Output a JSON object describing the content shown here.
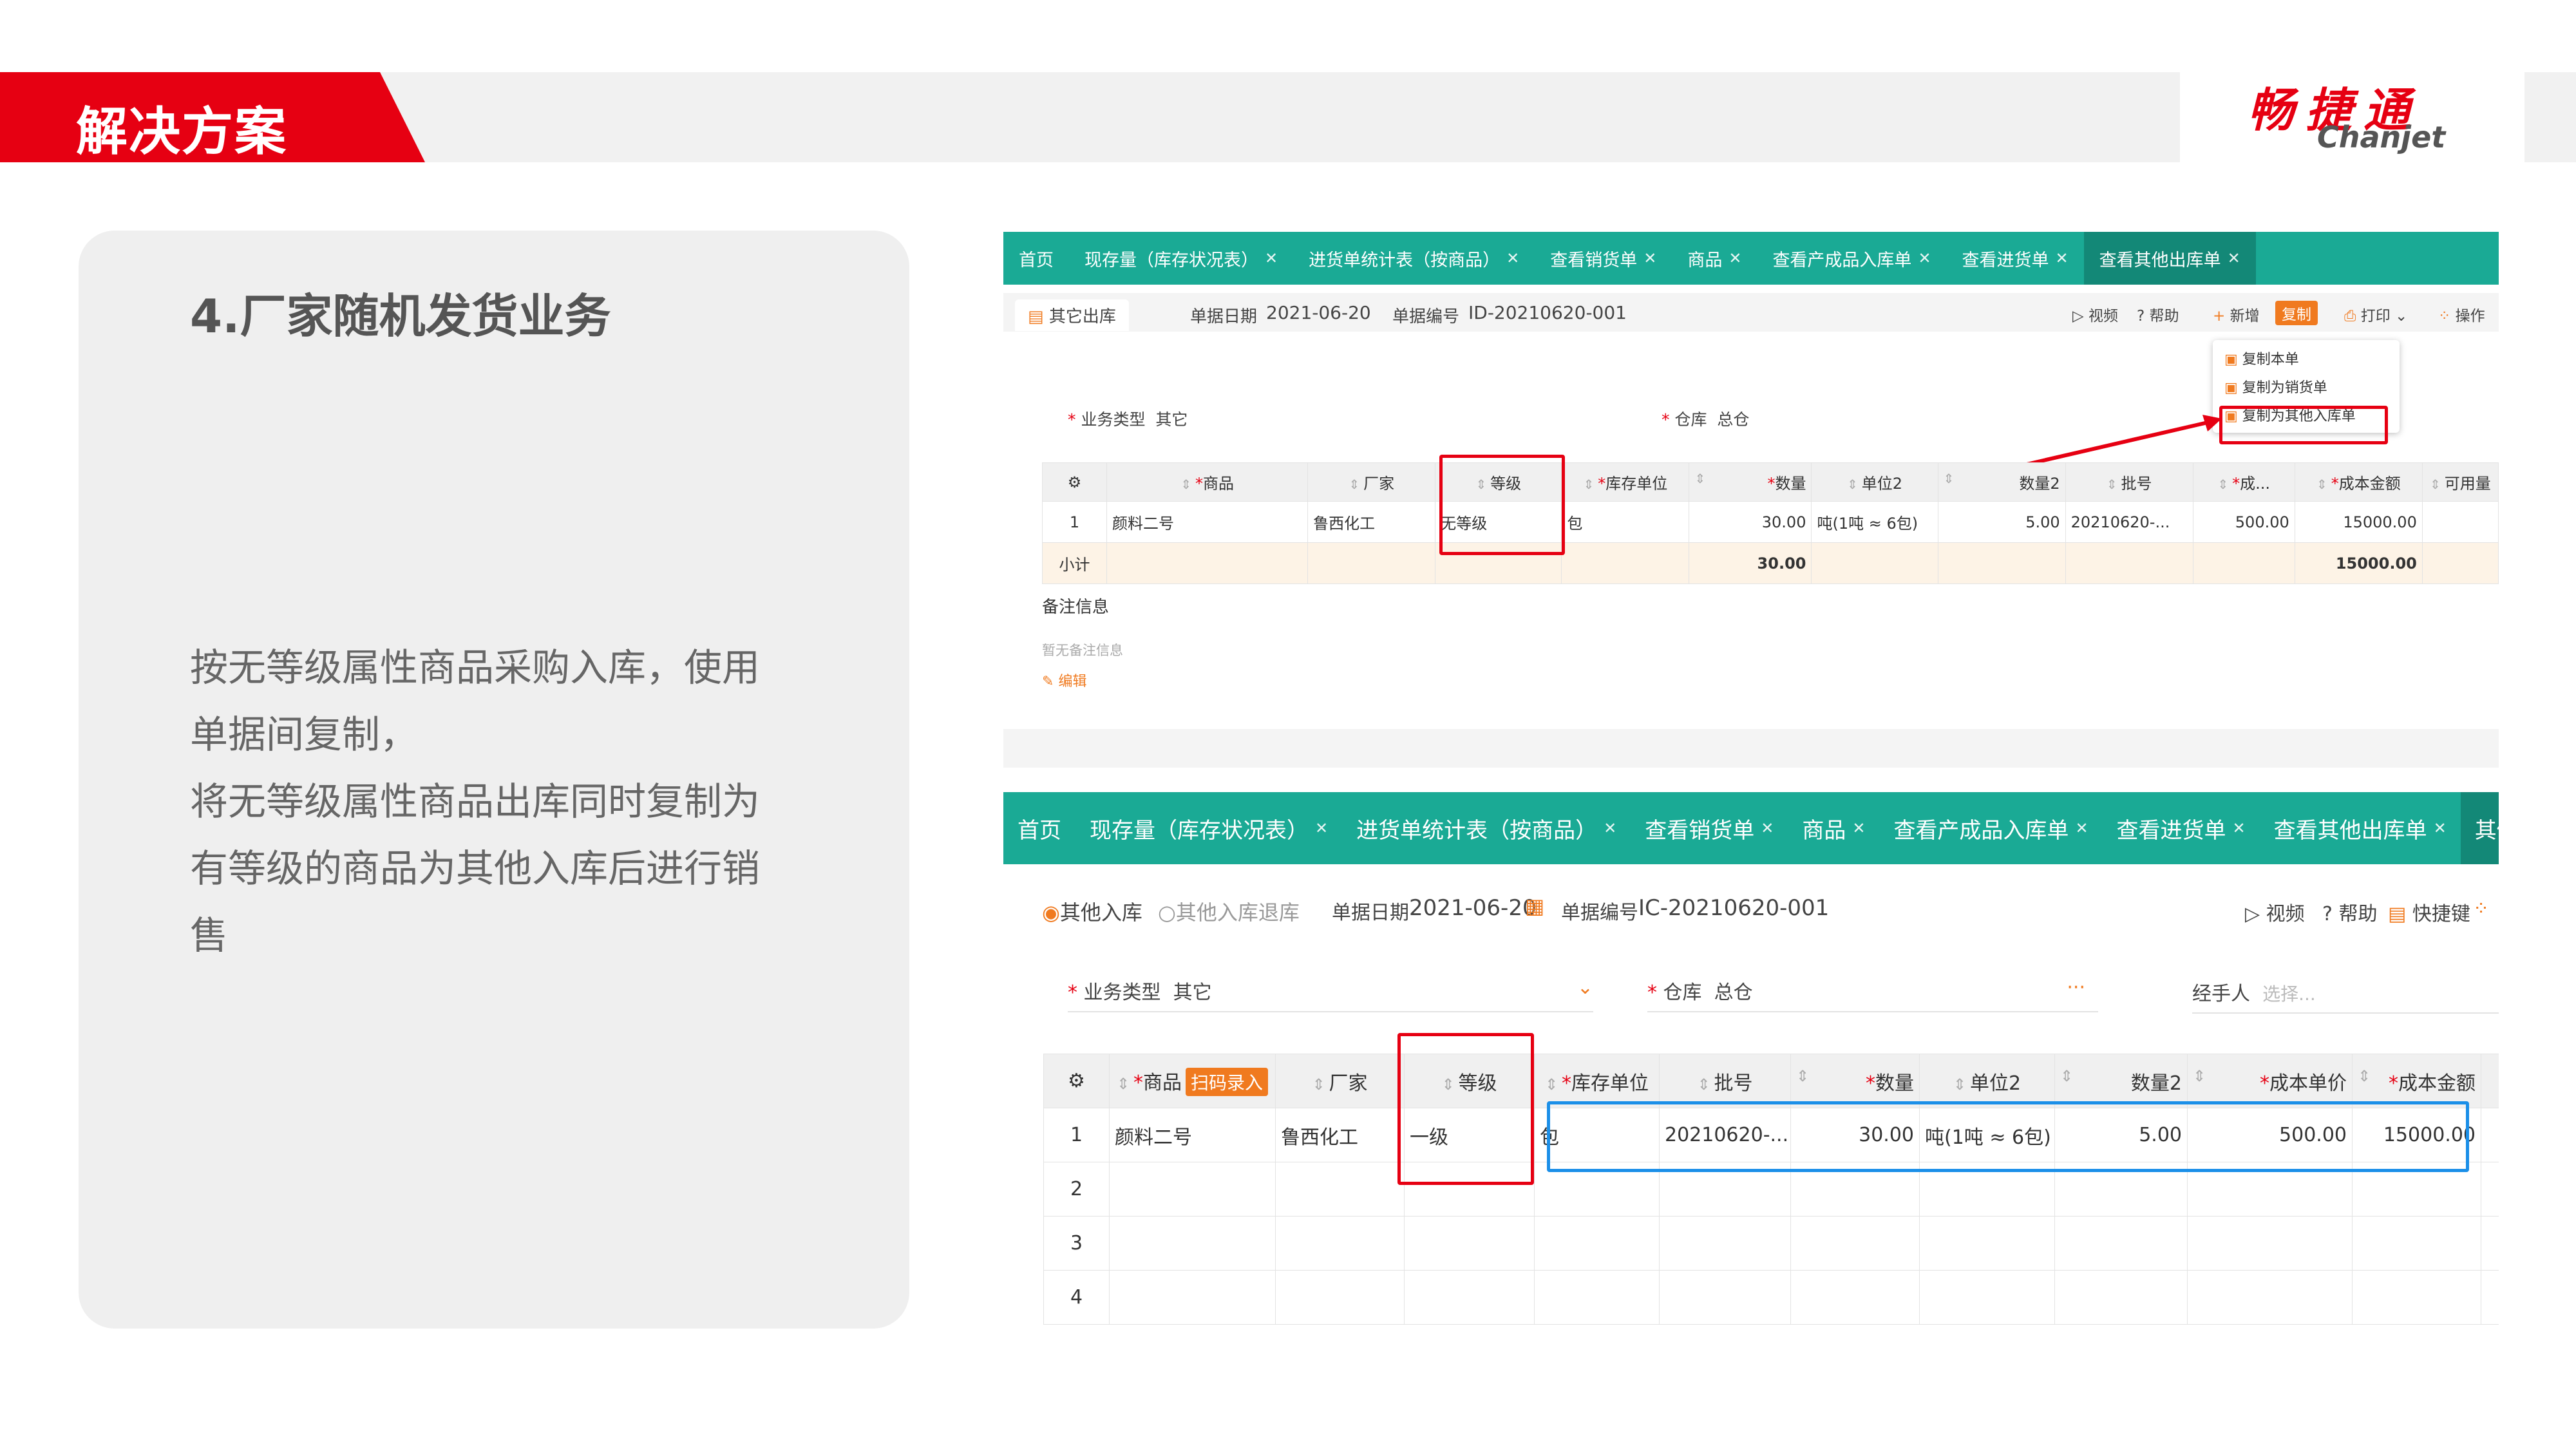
{
  "slide": {
    "section_tab": "解决方案",
    "logo_cn": "畅捷通",
    "logo_en": "Chanjet",
    "title": "4.厂家随机发货业务",
    "body_lines": [
      "按无等级属性商品采购入库，使用",
      "单据间复制，",
      "将无等级属性商品出库同时复制为",
      "有等级的商品为其他入库后进行销",
      "售"
    ],
    "colors": {
      "brand_red": "#e60012",
      "tab_teal": "#1aaa95",
      "highlight_blue": "#1b8fe8"
    }
  },
  "screen1": {
    "tabs": [
      {
        "label": "首页",
        "closable": false
      },
      {
        "label": "现存量（库存状况表）",
        "closable": true
      },
      {
        "label": "进货单统计表（按商品）",
        "closable": true
      },
      {
        "label": "查看销货单",
        "closable": true
      },
      {
        "label": "商品",
        "closable": true
      },
      {
        "label": "查看产成品入库单",
        "closable": true
      },
      {
        "label": "查看进货单",
        "closable": true
      },
      {
        "label": "查看其他出库单",
        "closable": true,
        "active": true
      }
    ],
    "doc_type": "其它出库",
    "date_label": "单据日期",
    "date_value": "2021-06-20",
    "code_label": "单据编号",
    "code_value": "ID-20210620-001",
    "toolbar": {
      "video": "视频",
      "help": "帮助",
      "add": "新增",
      "copy": "复制",
      "print": "打印",
      "ops": "操作"
    },
    "dropdown": [
      "复制本单",
      "复制为销货单",
      "复制为其他入库单"
    ],
    "biz_type_label": "业务类型",
    "biz_type_value": "其它",
    "warehouse_label": "仓库",
    "warehouse_value": "总仓",
    "columns": [
      "",
      "商品",
      "厂家",
      "等级",
      "库存单位",
      "数量",
      "单位2",
      "数量2",
      "批号",
      "成...",
      "成本金额",
      "可用量"
    ],
    "rows": [
      {
        "no": "1",
        "product": "颜料二号",
        "maker": "鲁西化工",
        "grade": "无等级",
        "unit": "包",
        "qty": "30.00",
        "unit2": "吨(1吨 ≈ 6包)",
        "qty2": "5.00",
        "batch": "20210620-...",
        "cost": "500.00",
        "amount": "15000.00"
      }
    ],
    "subtotal_label": "小计",
    "subtotal_qty": "30.00",
    "subtotal_amount": "15000.00",
    "remarks_label": "备注信息",
    "remarks_empty": "暂无备注信息",
    "edit_label": "编辑"
  },
  "screen2": {
    "tabs": [
      {
        "label": "首页",
        "closable": false
      },
      {
        "label": "现存量（库存状况表）",
        "closable": true
      },
      {
        "label": "进货单统计表（按商品）",
        "closable": true
      },
      {
        "label": "查看销货单",
        "closable": true
      },
      {
        "label": "商品",
        "closable": true
      },
      {
        "label": "查看产成品入库单",
        "closable": true
      },
      {
        "label": "查看进货单",
        "closable": true
      },
      {
        "label": "查看其他出库单",
        "closable": true
      },
      {
        "label": "其他入",
        "closable": false,
        "active": true
      }
    ],
    "radio_in": "其他入库",
    "radio_return": "其他入库退库",
    "date_label": "单据日期",
    "date_value": "2021-06-20",
    "code_label": "单据编号",
    "code_value": "IC-20210620-001",
    "toolbar": {
      "video": "视频",
      "help": "帮助",
      "shortcut": "快捷键"
    },
    "biz_type_label": "业务类型",
    "biz_type_value": "其它",
    "warehouse_label": "仓库",
    "warehouse_value": "总仓",
    "handler_label": "经手人",
    "handler_placeholder": "选择...",
    "scan_tag": "扫码录入",
    "columns": [
      "",
      "商品",
      "厂家",
      "等级",
      "库存单位",
      "批号",
      "数量",
      "单位2",
      "数量2",
      "成本单价",
      "成本金额"
    ],
    "rows": [
      {
        "no": "1",
        "product": "颜料二号",
        "maker": "鲁西化工",
        "grade": "一级",
        "unit": "包",
        "batch": "20210620-...",
        "qty": "30.00",
        "unit2": "吨(1吨 ≈ 6包)",
        "qty2": "5.00",
        "cost": "500.00",
        "amount": "15000.00"
      },
      {
        "no": "2"
      },
      {
        "no": "3"
      },
      {
        "no": "4"
      }
    ]
  }
}
